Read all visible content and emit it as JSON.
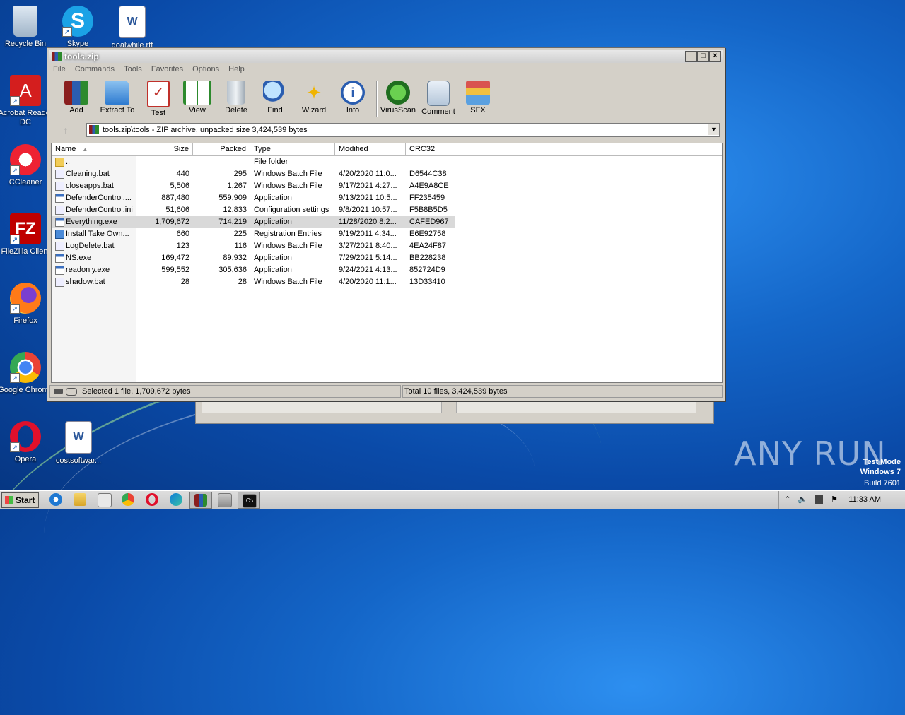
{
  "desktop": {
    "icons": [
      {
        "label": "Recycle Bin",
        "icon": "recycle-bin-icon"
      },
      {
        "label": "Skype",
        "icon": "skype-icon"
      },
      {
        "label": "goalwhile.rtf",
        "icon": "word-doc-icon"
      },
      {
        "label": "Acrobat Reader DC",
        "icon": "acrobat-icon"
      },
      {
        "label": "CCleaner",
        "icon": "ccleaner-icon"
      },
      {
        "label": "FileZilla Client",
        "icon": "filezilla-icon"
      },
      {
        "label": "Firefox",
        "icon": "firefox-icon"
      },
      {
        "label": "Google Chrome",
        "icon": "chrome-icon"
      },
      {
        "label": "Opera",
        "icon": "opera-icon"
      },
      {
        "label": "costsoftwar...",
        "icon": "word-doc-icon"
      }
    ]
  },
  "window": {
    "title": "tools.zip",
    "controls": {
      "minimize": "_",
      "maximize": "□",
      "close": "×"
    },
    "menu": [
      "File",
      "Commands",
      "Tools",
      "Favorites",
      "Options",
      "Help"
    ],
    "toolbar": [
      "Add",
      "Extract To",
      "Test",
      "View",
      "Delete",
      "Find",
      "Wizard",
      "Info",
      "VirusScan",
      "Comment",
      "SFX"
    ],
    "address": "tools.zip\\tools - ZIP archive, unpacked size 3,424,539 bytes",
    "columns": [
      "Name",
      "Size",
      "Packed",
      "Type",
      "Modified",
      "CRC32"
    ],
    "files": [
      {
        "name": "..",
        "size": "",
        "packed": "",
        "type": "File folder",
        "modified": "",
        "crc": "",
        "kind": "folder"
      },
      {
        "name": "Cleaning.bat",
        "size": "440",
        "packed": "295",
        "type": "Windows Batch File",
        "modified": "4/20/2020 11:0...",
        "crc": "D6544C38",
        "kind": "bat"
      },
      {
        "name": "closeapps.bat",
        "size": "5,506",
        "packed": "1,267",
        "type": "Windows Batch File",
        "modified": "9/17/2021 4:27...",
        "crc": "A4E9A8CE",
        "kind": "bat"
      },
      {
        "name": "DefenderControl....",
        "size": "887,480",
        "packed": "559,909",
        "type": "Application",
        "modified": "9/13/2021 10:5...",
        "crc": "FF235459",
        "kind": "app"
      },
      {
        "name": "DefenderControl.ini",
        "size": "51,606",
        "packed": "12,833",
        "type": "Configuration settings",
        "modified": "9/8/2021 10:57...",
        "crc": "F5B8B5D5",
        "kind": "ini"
      },
      {
        "name": "Everything.exe",
        "size": "1,709,672",
        "packed": "714,219",
        "type": "Application",
        "modified": "11/28/2020 8:2...",
        "crc": "CAFED967",
        "kind": "app"
      },
      {
        "name": "Install Take Own...",
        "size": "660",
        "packed": "225",
        "type": "Registration Entries",
        "modified": "9/19/2011 4:34...",
        "crc": "E6E92758",
        "kind": "reg"
      },
      {
        "name": "LogDelete.bat",
        "size": "123",
        "packed": "116",
        "type": "Windows Batch File",
        "modified": "3/27/2021 8:40...",
        "crc": "4EA24F87",
        "kind": "bat"
      },
      {
        "name": "NS.exe",
        "size": "169,472",
        "packed": "89,932",
        "type": "Application",
        "modified": "7/29/2021 5:14...",
        "crc": "BB228238",
        "kind": "app"
      },
      {
        "name": "readonly.exe",
        "size": "599,552",
        "packed": "305,636",
        "type": "Application",
        "modified": "9/24/2021 4:13...",
        "crc": "852724D9",
        "kind": "app"
      },
      {
        "name": "shadow.bat",
        "size": "28",
        "packed": "28",
        "type": "Windows Batch File",
        "modified": "4/20/2020 11:1...",
        "crc": "13D33410",
        "kind": "bat"
      }
    ],
    "status_left": "Selected 1 file, 1,709,672 bytes",
    "status_right": "Total 10 files, 3,424,539 bytes"
  },
  "watermark": {
    "brand": "ANY RUN",
    "mode": "Test Mode",
    "os": "Windows 7",
    "build": "Build 7601"
  },
  "taskbar": {
    "start_label": "Start",
    "clock": "11:33 AM"
  }
}
